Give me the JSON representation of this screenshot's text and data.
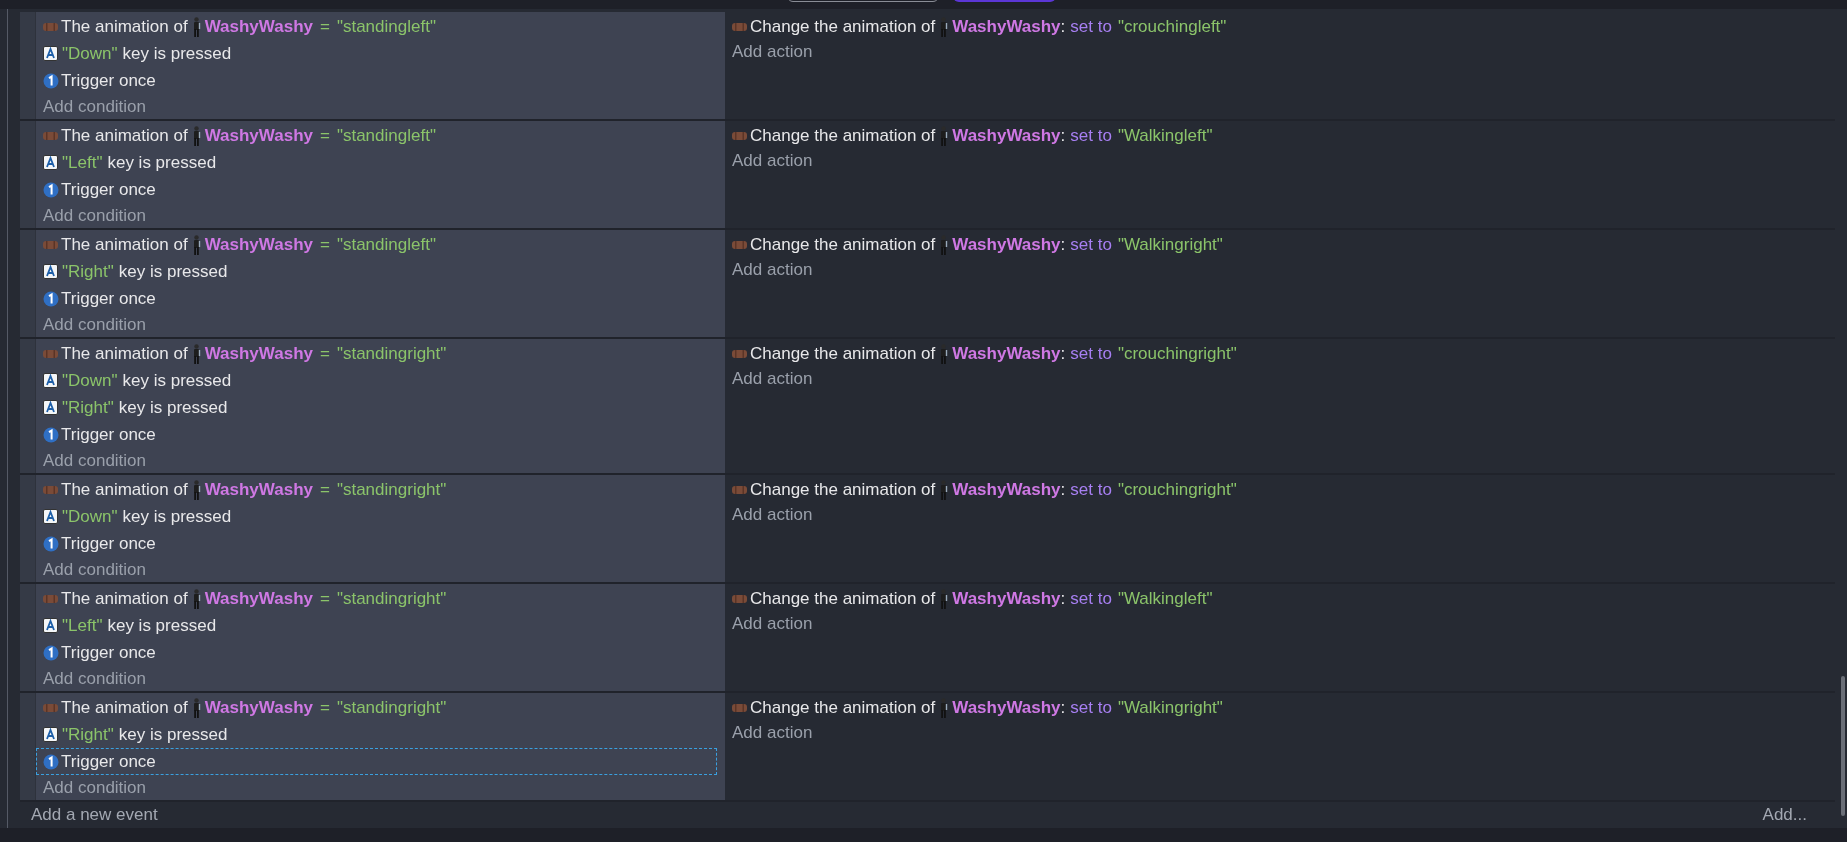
{
  "events": [
    {
      "conditions": [
        {
          "kind": "animation",
          "prefix": "The animation of",
          "object": "WashyWashy",
          "operator": "=",
          "value": "\"standingleft\"",
          "selected": false
        },
        {
          "kind": "key",
          "value": "\"Down\"",
          "text": "key is pressed",
          "selected": false
        },
        {
          "kind": "trigger",
          "text": "Trigger once",
          "selected": false
        }
      ],
      "add_condition": "Add condition",
      "actions": [
        {
          "prefix": "Change the animation of",
          "object": "WashyWashy",
          "separator": ":",
          "verb": "set to",
          "value": "\"crouchingleft\""
        }
      ],
      "add_action": "Add action"
    },
    {
      "conditions": [
        {
          "kind": "animation",
          "prefix": "The animation of",
          "object": "WashyWashy",
          "operator": "=",
          "value": "\"standingleft\"",
          "selected": false
        },
        {
          "kind": "key",
          "value": "\"Left\"",
          "text": "key is pressed",
          "selected": false
        },
        {
          "kind": "trigger",
          "text": "Trigger once",
          "selected": false
        }
      ],
      "add_condition": "Add condition",
      "actions": [
        {
          "prefix": "Change the animation of",
          "object": "WashyWashy",
          "separator": ":",
          "verb": "set to",
          "value": "\"Walkingleft\""
        }
      ],
      "add_action": "Add action"
    },
    {
      "conditions": [
        {
          "kind": "animation",
          "prefix": "The animation of",
          "object": "WashyWashy",
          "operator": "=",
          "value": "\"standingleft\"",
          "selected": false
        },
        {
          "kind": "key",
          "value": "\"Right\"",
          "text": "key is pressed",
          "selected": false
        },
        {
          "kind": "trigger",
          "text": "Trigger once",
          "selected": false
        }
      ],
      "add_condition": "Add condition",
      "actions": [
        {
          "prefix": "Change the animation of",
          "object": "WashyWashy",
          "separator": ":",
          "verb": "set to",
          "value": "\"Walkingright\""
        }
      ],
      "add_action": "Add action"
    },
    {
      "conditions": [
        {
          "kind": "animation",
          "prefix": "The animation of",
          "object": "WashyWashy",
          "operator": "=",
          "value": "\"standingright\"",
          "selected": false
        },
        {
          "kind": "key",
          "value": "\"Down\"",
          "text": "key is pressed",
          "selected": false
        },
        {
          "kind": "key",
          "value": "\"Right\"",
          "text": "key is pressed",
          "selected": false
        },
        {
          "kind": "trigger",
          "text": "Trigger once",
          "selected": false
        }
      ],
      "add_condition": "Add condition",
      "actions": [
        {
          "prefix": "Change the animation of",
          "object": "WashyWashy",
          "separator": ":",
          "verb": "set to",
          "value": "\"crouchingright\""
        }
      ],
      "add_action": "Add action"
    },
    {
      "conditions": [
        {
          "kind": "animation",
          "prefix": "The animation of",
          "object": "WashyWashy",
          "operator": "=",
          "value": "\"standingright\"",
          "selected": false
        },
        {
          "kind": "key",
          "value": "\"Down\"",
          "text": "key is pressed",
          "selected": false
        },
        {
          "kind": "trigger",
          "text": "Trigger once",
          "selected": false
        }
      ],
      "add_condition": "Add condition",
      "actions": [
        {
          "prefix": "Change the animation of",
          "object": "WashyWashy",
          "separator": ":",
          "verb": "set to",
          "value": "\"crouchingright\""
        }
      ],
      "add_action": "Add action"
    },
    {
      "conditions": [
        {
          "kind": "animation",
          "prefix": "The animation of",
          "object": "WashyWashy",
          "operator": "=",
          "value": "\"standingright\"",
          "selected": false
        },
        {
          "kind": "key",
          "value": "\"Left\"",
          "text": "key is pressed",
          "selected": false
        },
        {
          "kind": "trigger",
          "text": "Trigger once",
          "selected": false
        }
      ],
      "add_condition": "Add condition",
      "actions": [
        {
          "prefix": "Change the animation of",
          "object": "WashyWashy",
          "separator": ":",
          "verb": "set to",
          "value": "\"Walkingleft\""
        }
      ],
      "add_action": "Add action"
    },
    {
      "conditions": [
        {
          "kind": "animation",
          "prefix": "The animation of",
          "object": "WashyWashy",
          "operator": "=",
          "value": "\"standingright\"",
          "selected": false
        },
        {
          "kind": "key",
          "value": "\"Right\"",
          "text": "key is pressed",
          "selected": false
        },
        {
          "kind": "trigger",
          "text": "Trigger once",
          "selected": true
        }
      ],
      "add_condition": "Add condition",
      "actions": [
        {
          "prefix": "Change the animation of",
          "object": "WashyWashy",
          "separator": ":",
          "verb": "set to",
          "value": "\"Walkingright\""
        }
      ],
      "add_action": "Add action"
    }
  ],
  "add_event": "Add a new event",
  "add_menu": "Add..."
}
